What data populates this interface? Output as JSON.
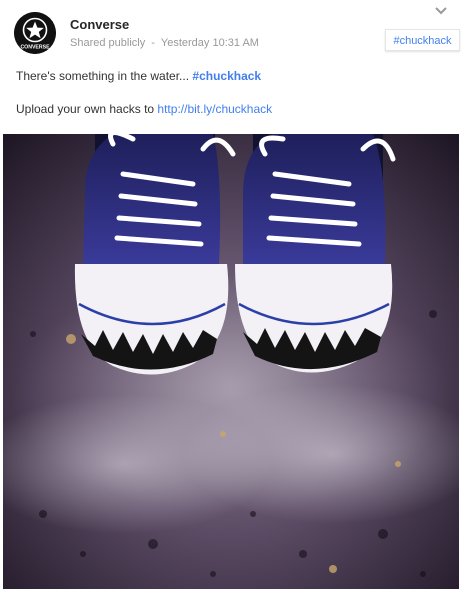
{
  "author": {
    "name": "Converse",
    "avatar_icon": "converse-star-logo",
    "logo_text": "CONVERSE"
  },
  "meta": {
    "visibility": "Shared publicly",
    "separator": "-",
    "timestamp": "Yesterday 10:31 AM"
  },
  "hashtag_chip": {
    "label": "#chuckhack"
  },
  "post": {
    "text_prefix": "There's something in the water... ",
    "hashtag": "#chuckhack",
    "upload_prefix": "Upload your own hacks to ",
    "link": "http://bit.ly/chuckhack"
  },
  "colors": {
    "link": "#427fed",
    "meta": "#999999"
  }
}
